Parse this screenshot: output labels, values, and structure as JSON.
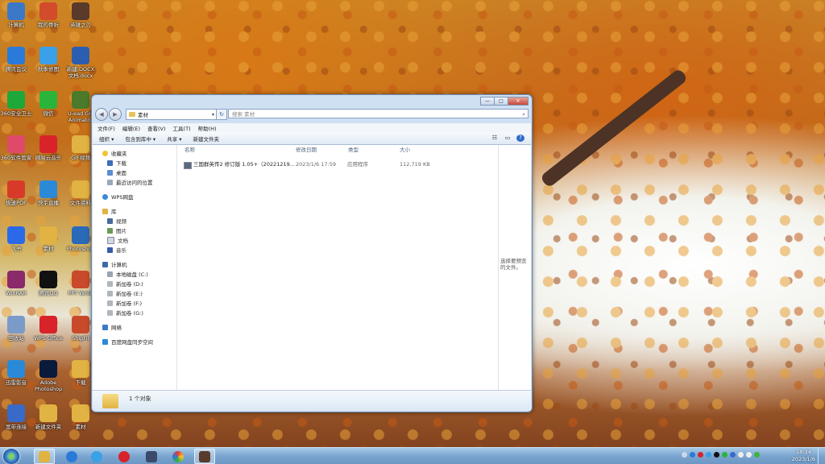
{
  "desktop": {
    "icons": [
      {
        "label": "计算机",
        "color": "#3c78c8"
      },
      {
        "label": "我的骨折",
        "color": "#d24b2a"
      },
      {
        "label": "英雄之刃",
        "color": "#5a3a2a"
      },
      {
        "label": "腾讯会议",
        "color": "#2a7bd9"
      },
      {
        "label": "秋季修图",
        "color": "#3aa0e8"
      },
      {
        "label": "新建 DOCX 文档.docx",
        "color": "#2b5eb0"
      },
      {
        "label": "360安全卫士",
        "color": "#1fa83a"
      },
      {
        "label": "微信",
        "color": "#2bb43a"
      },
      {
        "label": "U-ead GIF Animator",
        "color": "#4a7a2a"
      },
      {
        "label": "360软件管家",
        "color": "#e04a6a"
      },
      {
        "label": "网易云音乐",
        "color": "#d8232a"
      },
      {
        "label": "GIF视频",
        "color": "#e0b342"
      },
      {
        "label": "极速PDF",
        "color": "#d83a2a"
      },
      {
        "label": "快手直播",
        "color": "#2a8ad8"
      },
      {
        "label": "文件资料",
        "color": "#e0b342"
      },
      {
        "label": "飞书",
        "color": "#2a6ae8"
      },
      {
        "label": "素材",
        "color": "#e0b342"
      },
      {
        "label": "Photoshop",
        "color": "#2a6ab8"
      },
      {
        "label": "WinRAR",
        "color": "#8a2a6a"
      },
      {
        "label": "腾讯QQ",
        "color": "#111111"
      },
      {
        "label": "PPT Write",
        "color": "#c84a2a"
      },
      {
        "label": "回收站",
        "color": "#7a9ac8"
      },
      {
        "label": "WPS Office",
        "color": "#d8232a"
      },
      {
        "label": "ShipFit",
        "color": "#c84a2a"
      },
      {
        "label": "迅雷影音",
        "color": "#2a8ad8"
      },
      {
        "label": "Adobe Photoshop",
        "color": "#0a1a3a"
      },
      {
        "label": "下载",
        "color": "#e0b342"
      },
      {
        "label": "宽带连接",
        "color": "#3a6ac8"
      },
      {
        "label": "新建文件夹",
        "color": "#e0b342"
      },
      {
        "label": "素材",
        "color": "#e0b342"
      }
    ]
  },
  "window": {
    "path_label": "素材",
    "search_placeholder": "搜索 素材",
    "caption": {
      "min": "—",
      "max": "□",
      "close": "✕"
    },
    "menu": [
      "文件(F)",
      "编辑(E)",
      "查看(V)",
      "工具(T)",
      "帮助(H)"
    ],
    "toolbar": [
      "组织 ▾",
      "包含到库中 ▾",
      "共享 ▾",
      "新建文件夹"
    ],
    "nav": {
      "favorites_header": "收藏夹",
      "favorites": [
        "下载",
        "桌面",
        "最近访问的位置"
      ],
      "wps": "WPS网盘",
      "libraries_header": "库",
      "libraries": [
        "视频",
        "图片",
        "文档",
        "音乐"
      ],
      "computer_header": "计算机",
      "drives": [
        "本地磁盘 (C:)",
        "新加卷 (D:)",
        "新加卷 (E:)",
        "新加卷 (F:)",
        "新加卷 (G:)"
      ],
      "network": "网络",
      "baidu": "百度网盘同步空间"
    },
    "columns": {
      "name": "名称",
      "date": "修改日期",
      "type": "类型",
      "size": "大小"
    },
    "files": [
      {
        "name": "三国群英传2 修订版 1.05+（20221219...",
        "date": "2023/1/6 17:59",
        "type": "应用程序",
        "size": "112,719 KB"
      }
    ],
    "preview_text": "选择要预览的文件。",
    "status": "1 个对象"
  },
  "taskbar": {
    "time": "18:34",
    "date": "2023/1/6",
    "buttons": [
      "explorer",
      "ie",
      "baidu-netdisk",
      "netease-music",
      "app-window",
      "color-app",
      "game-icon"
    ]
  }
}
